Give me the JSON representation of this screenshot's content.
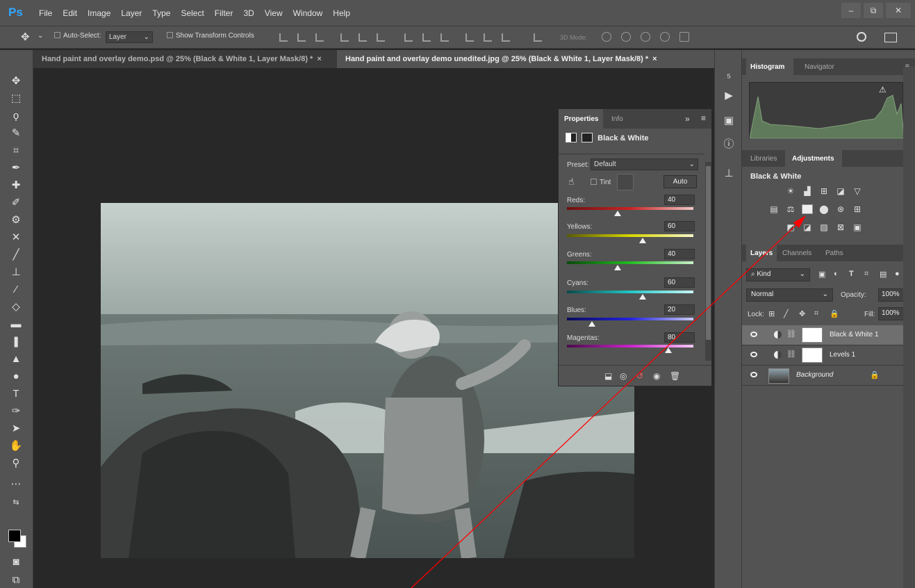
{
  "app": {
    "logo": "Ps"
  },
  "menu": [
    "File",
    "Edit",
    "Image",
    "Layer",
    "Type",
    "Select",
    "Filter",
    "3D",
    "View",
    "Window",
    "Help"
  ],
  "window_controls": {
    "minimize": "–",
    "restore": "⧉",
    "close": "✕"
  },
  "options": {
    "auto_select_label": "Auto-Select:",
    "auto_select_value": "Layer",
    "show_transform_label": "Show Transform Controls",
    "three_d_mode_label": "3D Mode:"
  },
  "tabs": [
    {
      "label": "Hand paint and overlay demo.psd @ 25% (Black & White 1, Layer Mask/8) *",
      "close": "×",
      "active": false
    },
    {
      "label": "Hand paint and overlay demo unedited.jpg @ 25% (Black & White 1, Layer Mask/8) *",
      "close": "×",
      "active": true
    }
  ],
  "properties": {
    "tab_properties": "Properties",
    "tab_info": "Info",
    "collapse": "»",
    "menu": "≡",
    "title": "Black & White",
    "preset_label": "Preset:",
    "preset_value": "Default",
    "tint_label": "Tint",
    "auto_label": "Auto",
    "sliders": [
      {
        "label": "Reds:",
        "value": "40",
        "pct": 40,
        "gradient": [
          "#6b1010",
          "#cc2222",
          "#f0c8c8"
        ]
      },
      {
        "label": "Yellows:",
        "value": "60",
        "pct": 60,
        "gradient": [
          "#5a5a00",
          "#d6d600",
          "#f6f6c8"
        ]
      },
      {
        "label": "Greens:",
        "value": "40",
        "pct": 40,
        "gradient": [
          "#0a4a0a",
          "#22bb22",
          "#c8f0c8"
        ]
      },
      {
        "label": "Cyans:",
        "value": "60",
        "pct": 60,
        "gradient": [
          "#0a4a4a",
          "#22c8c8",
          "#c8f6f6"
        ]
      },
      {
        "label": "Blues:",
        "value": "20",
        "pct": 20,
        "gradient": [
          "#0a0a5a",
          "#2222dd",
          "#c8c8f6"
        ]
      },
      {
        "label": "Magentas:",
        "value": "80",
        "pct": 80,
        "gradient": [
          "#4a0a4a",
          "#cc22cc",
          "#f6c8f6"
        ]
      }
    ]
  },
  "panels": {
    "histogram_tab": "Histogram",
    "navigator_tab": "Navigator",
    "libraries_tab": "Libraries",
    "adjustments_tab": "Adjustments",
    "adjustments_title": "Black & White",
    "layers_tab": "Layers",
    "channels_tab": "Channels",
    "paths_tab": "Paths",
    "filter_kind": "Kind",
    "blend_mode": "Normal",
    "opacity_label": "Opacity:",
    "opacity_value": "100%",
    "lock_label": "Lock:",
    "fill_label": "Fill:",
    "fill_value": "100%"
  },
  "layers": [
    {
      "name": "Black & White 1",
      "selected": true
    },
    {
      "name": "Levels 1",
      "selected": false
    },
    {
      "name": "Background",
      "selected": false
    }
  ],
  "colors": {
    "foreground": "#000000",
    "background": "#ffffff",
    "annotation": "#ff0000"
  }
}
